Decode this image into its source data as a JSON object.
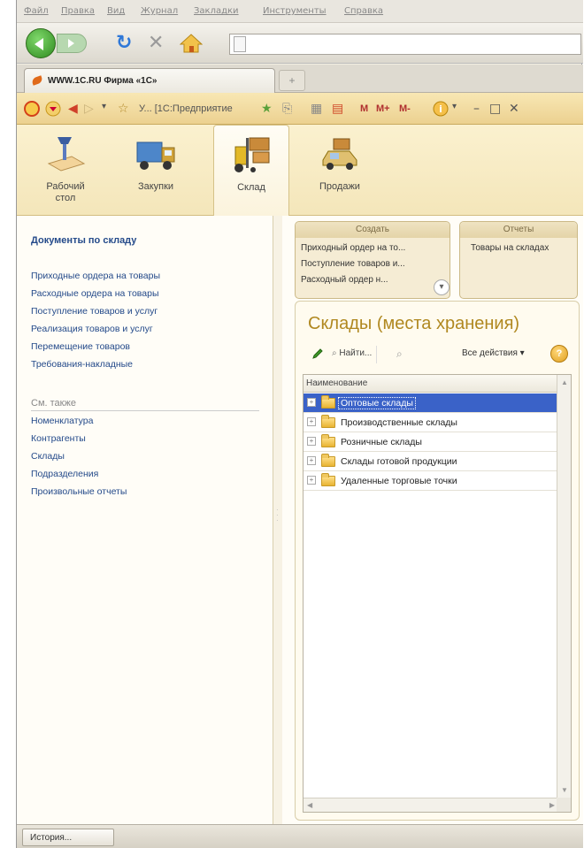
{
  "browser": {
    "menu": [
      "Файл",
      "Правка",
      "Вид",
      "Журнал",
      "Закладки",
      "Инструменты",
      "Справка"
    ],
    "tab_title": "WWW.1C.RU Фирма «1С»",
    "new_tab": "+"
  },
  "app_toolbar": {
    "title": "У... [1С:Предприятие",
    "m_buttons": [
      "M",
      "M+",
      "M-"
    ]
  },
  "sections": [
    {
      "label": "Рабочий\nстол",
      "icon": "desk-lamp-icon"
    },
    {
      "label": "Закупки",
      "icon": "truck-icon"
    },
    {
      "label": "Склад",
      "icon": "forklift-icon",
      "active": true
    },
    {
      "label": "Продажи",
      "icon": "delivery-car-icon"
    }
  ],
  "nav": {
    "heading": "Документы по складу",
    "links": [
      "Приходные ордера на товары",
      "Расходные ордера на товары",
      "Поступление товаров и услуг",
      "Реализация товаров и услуг",
      "Перемещение товаров",
      "Требования-накладные"
    ],
    "see_also": "См. также",
    "see_also_links": [
      "Номенклатура",
      "Контрагенты",
      "Склады",
      "Подразделения",
      "Произвольные отчеты"
    ]
  },
  "create_panel": {
    "header": "Создать",
    "items": [
      "Приходный ордер на то...",
      "Поступление товаров и...",
      "Расходный ордер н..."
    ]
  },
  "reports_panel": {
    "header": "Отчеты",
    "items": [
      "Товары на складах"
    ]
  },
  "form": {
    "title": "Склады (места хранения)",
    "find_label": "Найти...",
    "all_actions": "Все действия ▾",
    "help": "?",
    "column_header": "Наименование",
    "rows": [
      {
        "name": "Оптовые склады",
        "selected": true
      },
      {
        "name": "Производственные склады",
        "selected": false
      },
      {
        "name": "Розничные склады",
        "selected": false
      },
      {
        "name": "Склады готовой продукции",
        "selected": false
      },
      {
        "name": "Удаленные торговые точки",
        "selected": false
      }
    ]
  },
  "status": {
    "history_button": "История..."
  }
}
